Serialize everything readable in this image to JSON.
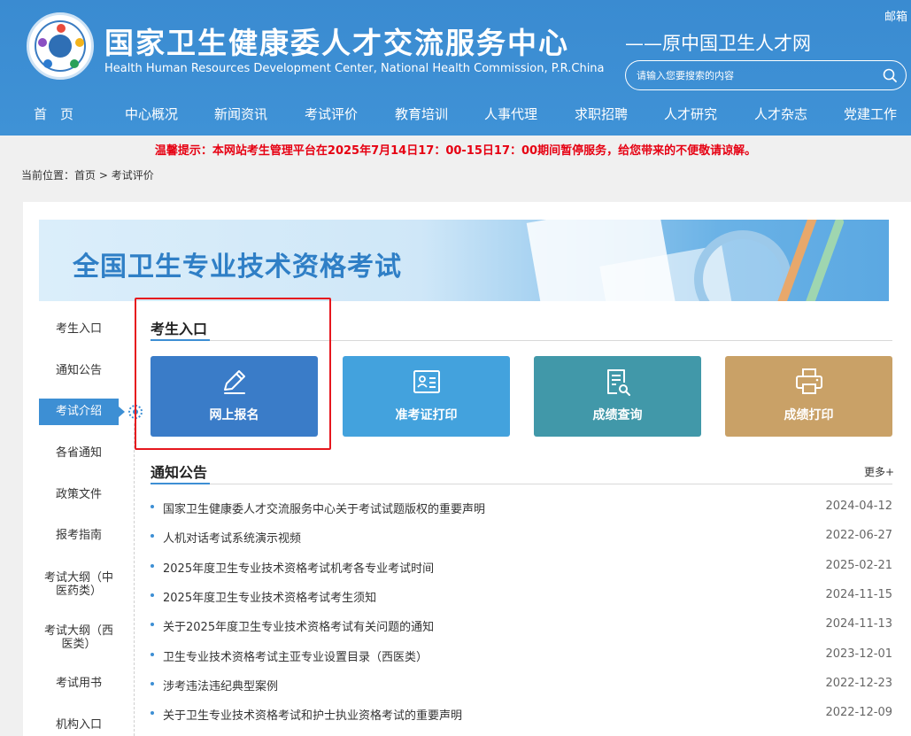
{
  "header": {
    "mailbox": "邮箱",
    "title_cn": "国家卫生健康委人才交流服务中心",
    "title_en": "Health Human Resources Development Center, National Health Commission, P.R.China",
    "subtitle": "——原中国卫生人才网",
    "search_placeholder": "请输入您要搜索的内容"
  },
  "nav": {
    "items": [
      "首　页",
      "中心概况",
      "新闻资讯",
      "考试评价",
      "教育培训",
      "人事代理",
      "求职招聘",
      "人才研究",
      "人才杂志",
      "党建工作"
    ]
  },
  "notice": "温馨提示：本网站考生管理平台在2025年7月14日17：00-15日17：00期间暂停服务，给您带来的不便敬请谅解。",
  "breadcrumb": {
    "prefix": "当前位置：",
    "home": "首页",
    "sep": " > ",
    "current": "考试评价"
  },
  "banner": {
    "title": "全国卫生专业技术资格考试"
  },
  "sidebar": {
    "items": [
      "考生入口",
      "通知公告",
      "考试介绍",
      "各省通知",
      "政策文件",
      "报考指南",
      "考试大纲（中医药类）",
      "考试大纲（西医类）",
      "考试用书",
      "机构入口"
    ],
    "active": "考试介绍"
  },
  "entry": {
    "title": "考生入口",
    "tiles": [
      {
        "label": "网上报名",
        "icon": "pencil-icon",
        "color": "#3a7cc8"
      },
      {
        "label": "准考证打印",
        "icon": "id-card-icon",
        "color": "#43a2dd"
      },
      {
        "label": "成绩查询",
        "icon": "document-search-icon",
        "color": "#4198a9"
      },
      {
        "label": "成绩打印",
        "icon": "printer-icon",
        "color": "#c9a167"
      }
    ]
  },
  "news": {
    "title": "通知公告",
    "more": "更多+",
    "items": [
      {
        "title": "国家卫生健康委人才交流服务中心关于考试试题版权的重要声明",
        "date": "2024-04-12"
      },
      {
        "title": "人机对话考试系统演示视频",
        "date": "2022-06-27"
      },
      {
        "title": "2025年度卫生专业技术资格考试机考各专业考试时间",
        "date": "2025-02-21"
      },
      {
        "title": "2025年度卫生专业技术资格考试考生须知",
        "date": "2024-11-15"
      },
      {
        "title": "关于2025年度卫生专业技术资格考试有关问题的通知",
        "date": "2024-11-13"
      },
      {
        "title": "卫生专业技术资格考试主亚专业设置目录（西医类）",
        "date": "2023-12-01"
      },
      {
        "title": "涉考违法违纪典型案例",
        "date": "2022-12-23"
      },
      {
        "title": "关于卫生专业技术资格考试和护士执业资格考试的重要声明",
        "date": "2022-12-09"
      }
    ]
  },
  "colors": {
    "header_blue": "#3d8fd4",
    "notice_red": "#e60012",
    "highlight_red": "#e6171e"
  }
}
